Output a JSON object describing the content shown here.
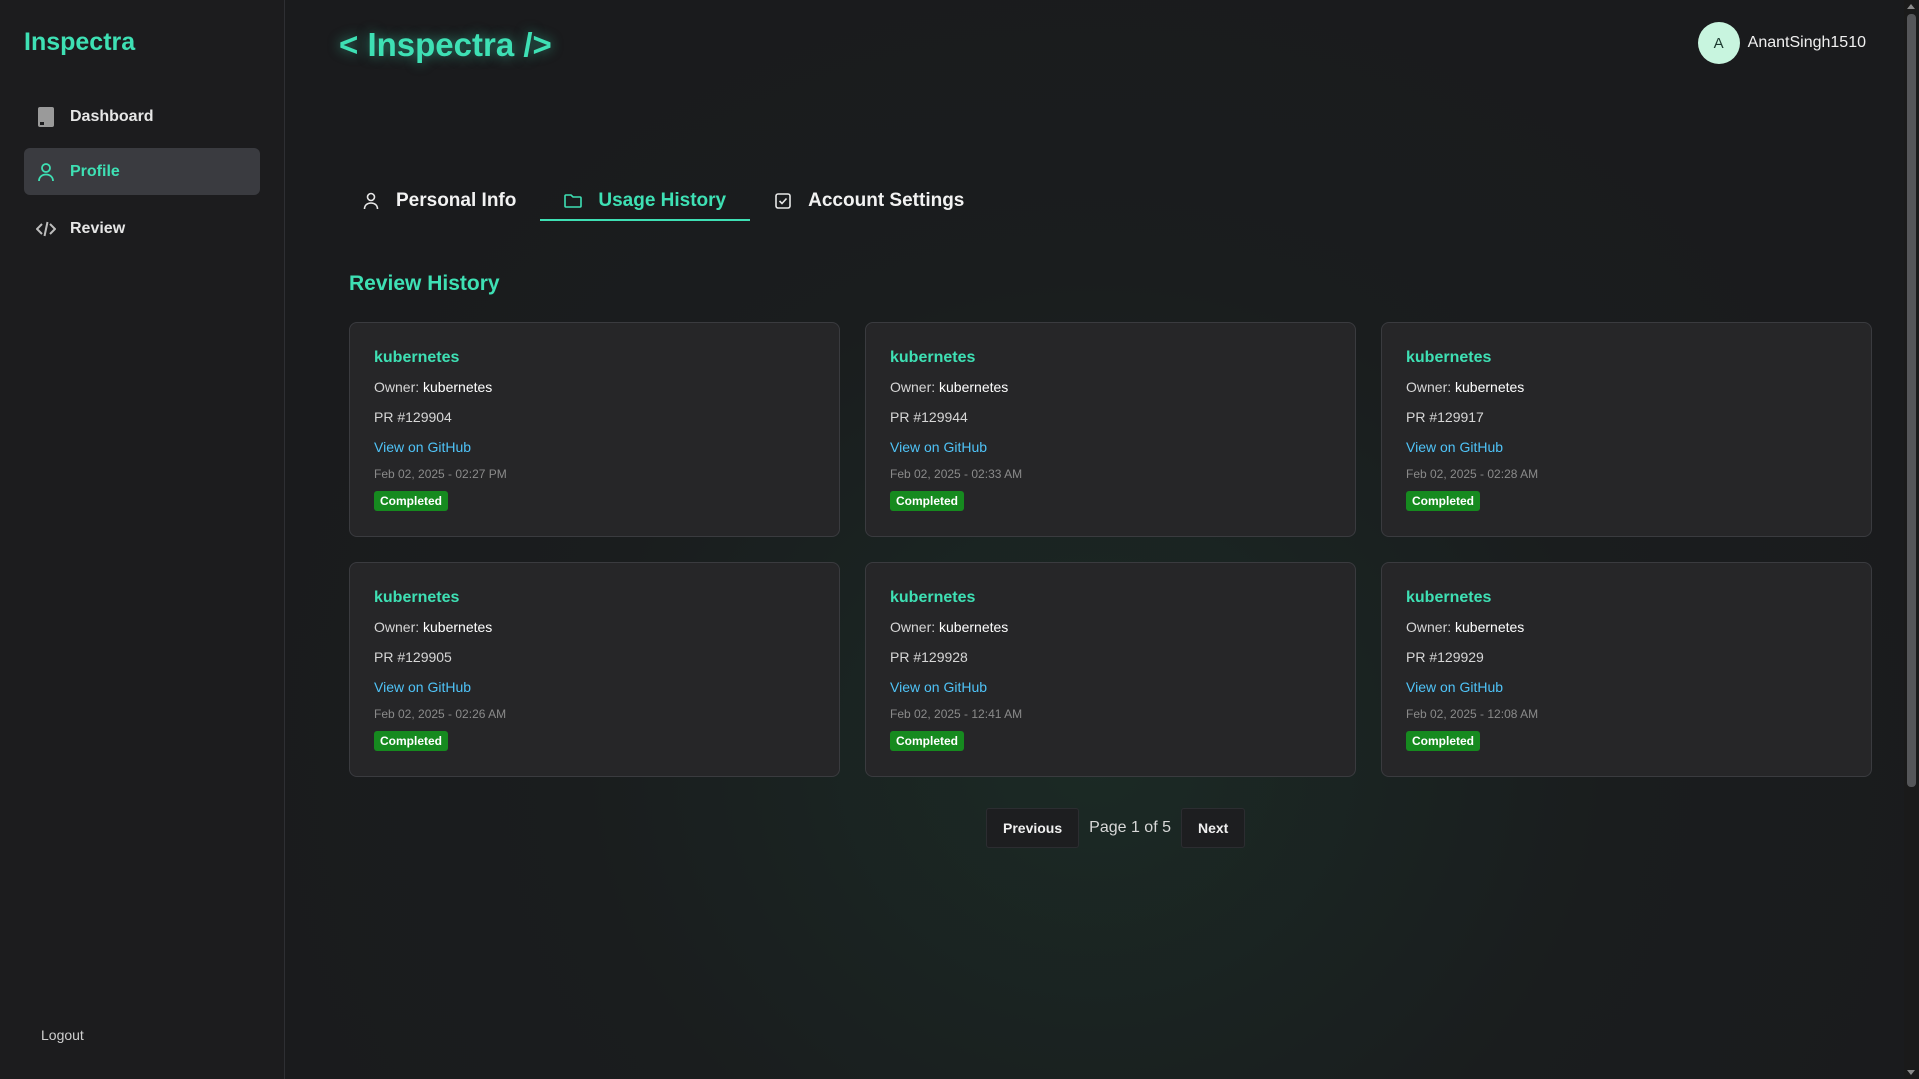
{
  "sidebar": {
    "brand": "Inspectra",
    "items": [
      {
        "label": "Dashboard",
        "icon": "document-icon",
        "active": false
      },
      {
        "label": "Profile",
        "icon": "user-icon",
        "active": true
      },
      {
        "label": "Review",
        "icon": "code-icon",
        "active": false
      }
    ],
    "logout": "Logout"
  },
  "header": {
    "logo": "< Inspectra />",
    "avatar_initial": "A",
    "username": "AnantSingh1510"
  },
  "tabs": [
    {
      "label": "Personal Info",
      "icon": "user-icon",
      "active": false
    },
    {
      "label": "Usage History",
      "icon": "folder-icon",
      "active": true
    },
    {
      "label": "Account Settings",
      "icon": "checkbox-icon",
      "active": false
    }
  ],
  "section_title": "Review History",
  "owner_label": "Owner:",
  "cards": [
    {
      "repo": "kubernetes",
      "owner": "kubernetes",
      "pr": "PR #129904",
      "link": "View on GitHub",
      "date": "Feb 02, 2025 - 02:27 PM",
      "status": "Completed"
    },
    {
      "repo": "kubernetes",
      "owner": "kubernetes",
      "pr": "PR #129944",
      "link": "View on GitHub",
      "date": "Feb 02, 2025 - 02:33 AM",
      "status": "Completed"
    },
    {
      "repo": "kubernetes",
      "owner": "kubernetes",
      "pr": "PR #129917",
      "link": "View on GitHub",
      "date": "Feb 02, 2025 - 02:28 AM",
      "status": "Completed"
    },
    {
      "repo": "kubernetes",
      "owner": "kubernetes",
      "pr": "PR #129905",
      "link": "View on GitHub",
      "date": "Feb 02, 2025 - 02:26 AM",
      "status": "Completed"
    },
    {
      "repo": "kubernetes",
      "owner": "kubernetes",
      "pr": "PR #129928",
      "link": "View on GitHub",
      "date": "Feb 02, 2025 - 12:41 AM",
      "status": "Completed"
    },
    {
      "repo": "kubernetes",
      "owner": "kubernetes",
      "pr": "PR #129929",
      "link": "View on GitHub",
      "date": "Feb 02, 2025 - 12:08 AM",
      "status": "Completed"
    }
  ],
  "pagination": {
    "previous": "Previous",
    "label": "Page 1 of 5",
    "next": "Next"
  },
  "colors": {
    "accent": "#3ee0b4",
    "link": "#4fc3f7",
    "status_completed": "#168a1f"
  }
}
